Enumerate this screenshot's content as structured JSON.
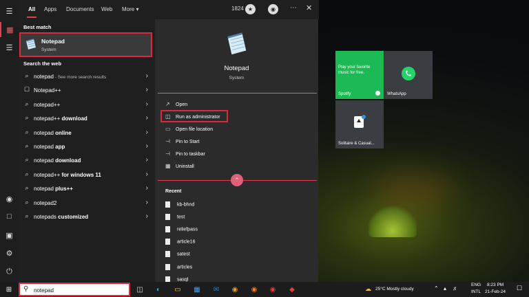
{
  "tabs": [
    {
      "label": "All"
    },
    {
      "label": "Apps"
    },
    {
      "label": "Documents"
    },
    {
      "label": "Web"
    },
    {
      "label": "More"
    }
  ],
  "topbar": {
    "points": "1824"
  },
  "best_match": {
    "heading": "Best match",
    "title": "Notepad",
    "subtitle": "System"
  },
  "search_web": {
    "heading": "Search the web"
  },
  "suggestions": [
    {
      "pre": "notepad",
      "bold": "",
      "sub": " - See more search results"
    },
    {
      "pre": "Notepad++",
      "bold": "",
      "sub": ""
    },
    {
      "pre": "notepad++",
      "bold": "",
      "sub": ""
    },
    {
      "pre": "notepad++ ",
      "bold": "download",
      "sub": ""
    },
    {
      "pre": "notepad ",
      "bold": "online",
      "sub": ""
    },
    {
      "pre": "notepad ",
      "bold": "app",
      "sub": ""
    },
    {
      "pre": "notepad ",
      "bold": "download",
      "sub": ""
    },
    {
      "pre": "notepad++ ",
      "bold": "for windows 11",
      "sub": ""
    },
    {
      "pre": "notepad ",
      "bold": "plus++",
      "sub": ""
    },
    {
      "pre": "notepad2",
      "bold": "",
      "sub": ""
    },
    {
      "pre": "notepads ",
      "bold": "customized",
      "sub": ""
    }
  ],
  "preview": {
    "title": "Notepad",
    "subtitle": "System"
  },
  "actions": [
    {
      "label": "Open"
    },
    {
      "label": "Run as administrator"
    },
    {
      "label": "Open file location"
    },
    {
      "label": "Pin to Start"
    },
    {
      "label": "Pin to taskbar"
    },
    {
      "label": "Uninstall"
    }
  ],
  "recent": {
    "heading": "Recent",
    "items": [
      "kb-bhnd",
      "test",
      "reliefpass",
      "article16",
      "satest",
      "articles",
      "sasql"
    ]
  },
  "tiles": {
    "spotify": {
      "promo": "Play your favorite music for free.",
      "label": "Spotify"
    },
    "whatsapp": {
      "label": "WhatsApp"
    },
    "solitaire": {
      "label": "Solitaire & Casual..."
    }
  },
  "search": {
    "value": "notepad"
  },
  "tray": {
    "weather": "25°C  Mostly cloudy",
    "lang1": "ENG",
    "lang2": "INTL",
    "time": "8:23 PM",
    "date": "21-Feb-24"
  },
  "colors": {
    "accent": "#e0283c",
    "spotify": "#1db954",
    "panel": "#2b2b2b"
  }
}
